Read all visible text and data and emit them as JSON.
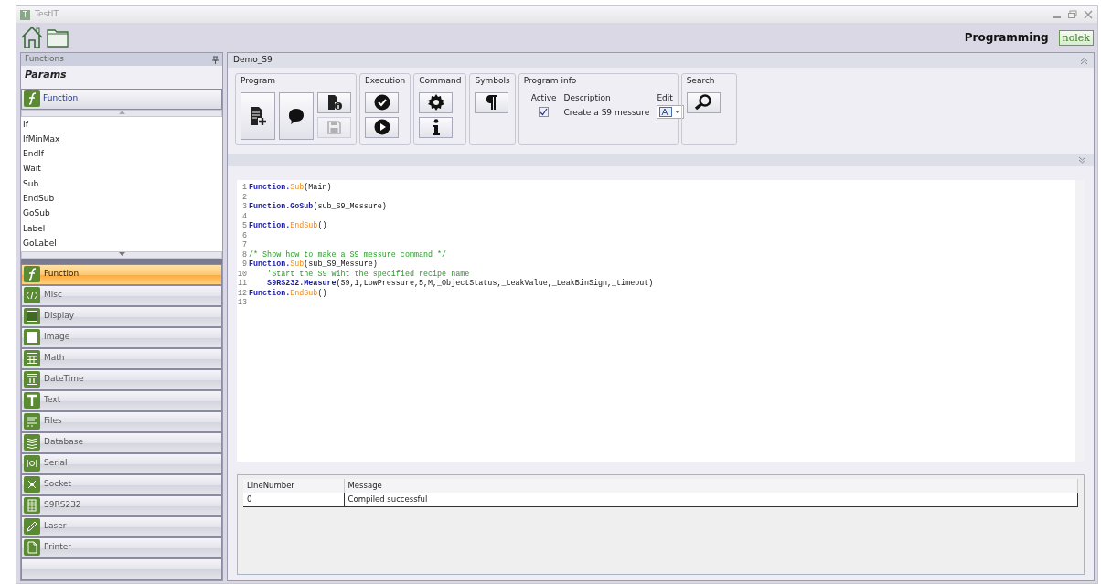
{
  "window": {
    "title": "TestIT",
    "app_icon_letter": "T"
  },
  "toolbar": {
    "section_title": "Programming",
    "logo": "nolek"
  },
  "left_panel": {
    "header": "Functions",
    "title": "Params",
    "group_button": "Function",
    "items": [
      "If",
      "IfMinMax",
      "EndIf",
      "Wait",
      "Sub",
      "EndSub",
      "GoSub",
      "Label",
      "GoLabel"
    ],
    "categories": [
      {
        "label": "Function",
        "selected": true
      },
      {
        "label": "Misc",
        "selected": false
      },
      {
        "label": "Display",
        "selected": false
      },
      {
        "label": "Image",
        "selected": false
      },
      {
        "label": "Math",
        "selected": false
      },
      {
        "label": "DateTime",
        "selected": false
      },
      {
        "label": "Text",
        "selected": false
      },
      {
        "label": "Files",
        "selected": false
      },
      {
        "label": "Database",
        "selected": false
      },
      {
        "label": "Serial",
        "selected": false
      },
      {
        "label": "Socket",
        "selected": false
      },
      {
        "label": "S9RS232",
        "selected": false
      },
      {
        "label": "Laser",
        "selected": false
      },
      {
        "label": "Printer",
        "selected": false
      }
    ]
  },
  "document": {
    "title": "Demo_S9",
    "ribbon": {
      "program": {
        "label": "Program",
        "save_disabled": true
      },
      "execution": {
        "label": "Execution"
      },
      "command": {
        "label": "Command"
      },
      "symbols": {
        "label": "Symbols"
      },
      "program_info": {
        "label": "Program info",
        "active_label": "Active",
        "active_checked": true,
        "description_label": "Description",
        "description": "Create a S9 messure",
        "edit_label": "Edit"
      },
      "search": {
        "label": "Search"
      }
    },
    "code_lines": [
      {
        "number": "1",
        "tokens": [
          {
            "kind": "object",
            "text": "Function."
          },
          {
            "kind": "method",
            "text": "Sub"
          },
          {
            "kind": "plain",
            "text": "(Main)"
          }
        ]
      },
      {
        "number": "2"
      },
      {
        "number": "3",
        "tokens": [
          {
            "kind": "object",
            "text": "Function."
          },
          {
            "kind": "object",
            "text": "GoSub"
          },
          {
            "kind": "plain",
            "text": "(sub_S9_Messure)"
          }
        ]
      },
      {
        "number": "4"
      },
      {
        "number": "5",
        "tokens": [
          {
            "kind": "object",
            "text": "Function."
          },
          {
            "kind": "method",
            "text": "EndSub"
          },
          {
            "kind": "plain",
            "text": "()"
          }
        ]
      },
      {
        "number": "6"
      },
      {
        "number": "7"
      },
      {
        "number": "8",
        "tokens": [
          {
            "kind": "comment",
            "text": "/* Show how to make a S9 messure command */"
          }
        ]
      },
      {
        "number": "9",
        "tokens": [
          {
            "kind": "object",
            "text": "Function."
          },
          {
            "kind": "method",
            "text": "Sub"
          },
          {
            "kind": "plain",
            "text": "(sub_S9_Messure)"
          }
        ]
      },
      {
        "number": "10",
        "tokens": [
          {
            "kind": "comment",
            "text": "    'Start the S9 wiht the specified recipe name"
          }
        ]
      },
      {
        "number": "11",
        "tokens": [
          {
            "kind": "object",
            "text": "    S9RS232.Measure"
          },
          {
            "kind": "plain",
            "text": "(S9,1,LowPressure,5,M,_ObjectStatus,_LeakValue,_LeakBinSign,_timeout)"
          }
        ]
      },
      {
        "number": "12",
        "tokens": [
          {
            "kind": "object",
            "text": "Function."
          },
          {
            "kind": "method",
            "text": "EndSub"
          },
          {
            "kind": "plain",
            "text": "()"
          }
        ]
      },
      {
        "number": "13"
      }
    ],
    "output_table": {
      "columns": [
        "LineNumber",
        "Message"
      ],
      "rows": [
        [
          "0",
          "Compiled successful"
        ]
      ]
    }
  }
}
